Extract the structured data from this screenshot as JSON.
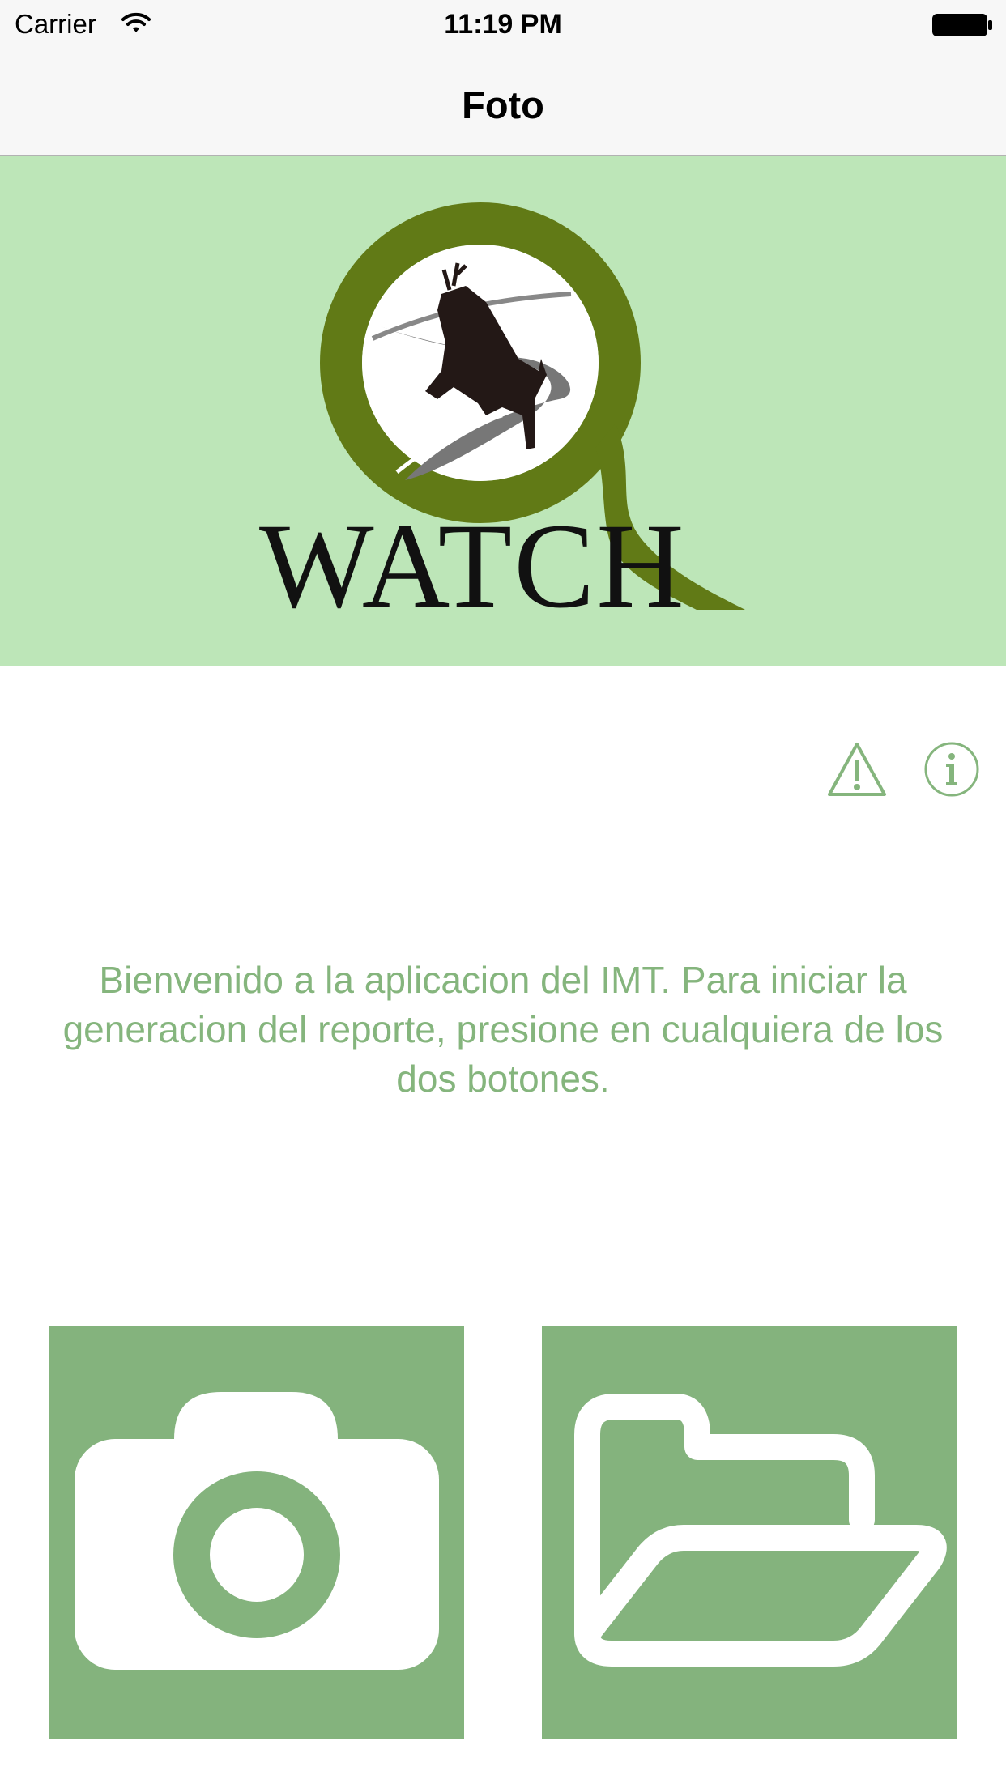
{
  "status_bar": {
    "carrier": "Carrier",
    "time": "11:19 PM",
    "wifi_icon": "wifi-icon",
    "battery_icon": "battery-icon"
  },
  "nav": {
    "title": "Foto"
  },
  "banner": {
    "logo_text": "WATCH",
    "logo_icon": "deer-road-magnifier-logo"
  },
  "toolbar": {
    "alert_icon": "warning-triangle-icon",
    "info_icon": "info-circle-icon"
  },
  "welcome_text": "Bienvenido a la aplicacion del IMT. Para iniciar la generacion del reporte, presione en cualquiera de los dos botones.",
  "actions": {
    "camera_icon": "camera-icon",
    "folder_icon": "folder-open-icon"
  },
  "colors": {
    "banner_bg": "#bde6b8",
    "accent_green": "#84b37d",
    "logo_green": "#617a16",
    "text_green": "#85b57d"
  }
}
